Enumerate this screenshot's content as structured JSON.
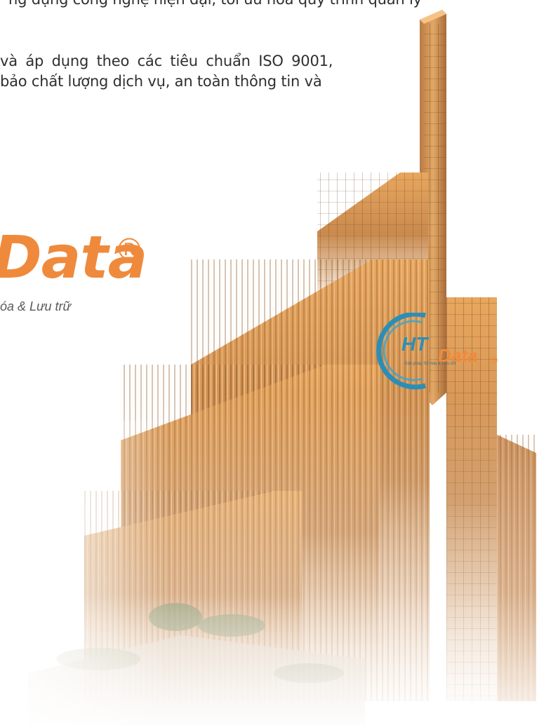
{
  "document": {
    "top_line": "ng dụng công nghệ hiện đại, tối ưu hóa quy trình quản lý",
    "paragraph_line_1": "và áp dụng theo các tiêu chuẩn ISO 9001,",
    "paragraph_line_2": "bảo chất lượng dịch vụ, an toàn thông tin và"
  },
  "brand": {
    "name": "Data",
    "registered": "®",
    "tagline": "óa & Lưu trữ"
  },
  "building_logo": {
    "initials": "HT",
    "name": "Data",
    "registered": "®",
    "slogan": "Giải pháp Số hóa & Lưu trữ"
  },
  "colors": {
    "accent_orange": "#ef8a3c",
    "logo_blue": "#2a8fb8",
    "text_dark": "#2f2f2f"
  }
}
